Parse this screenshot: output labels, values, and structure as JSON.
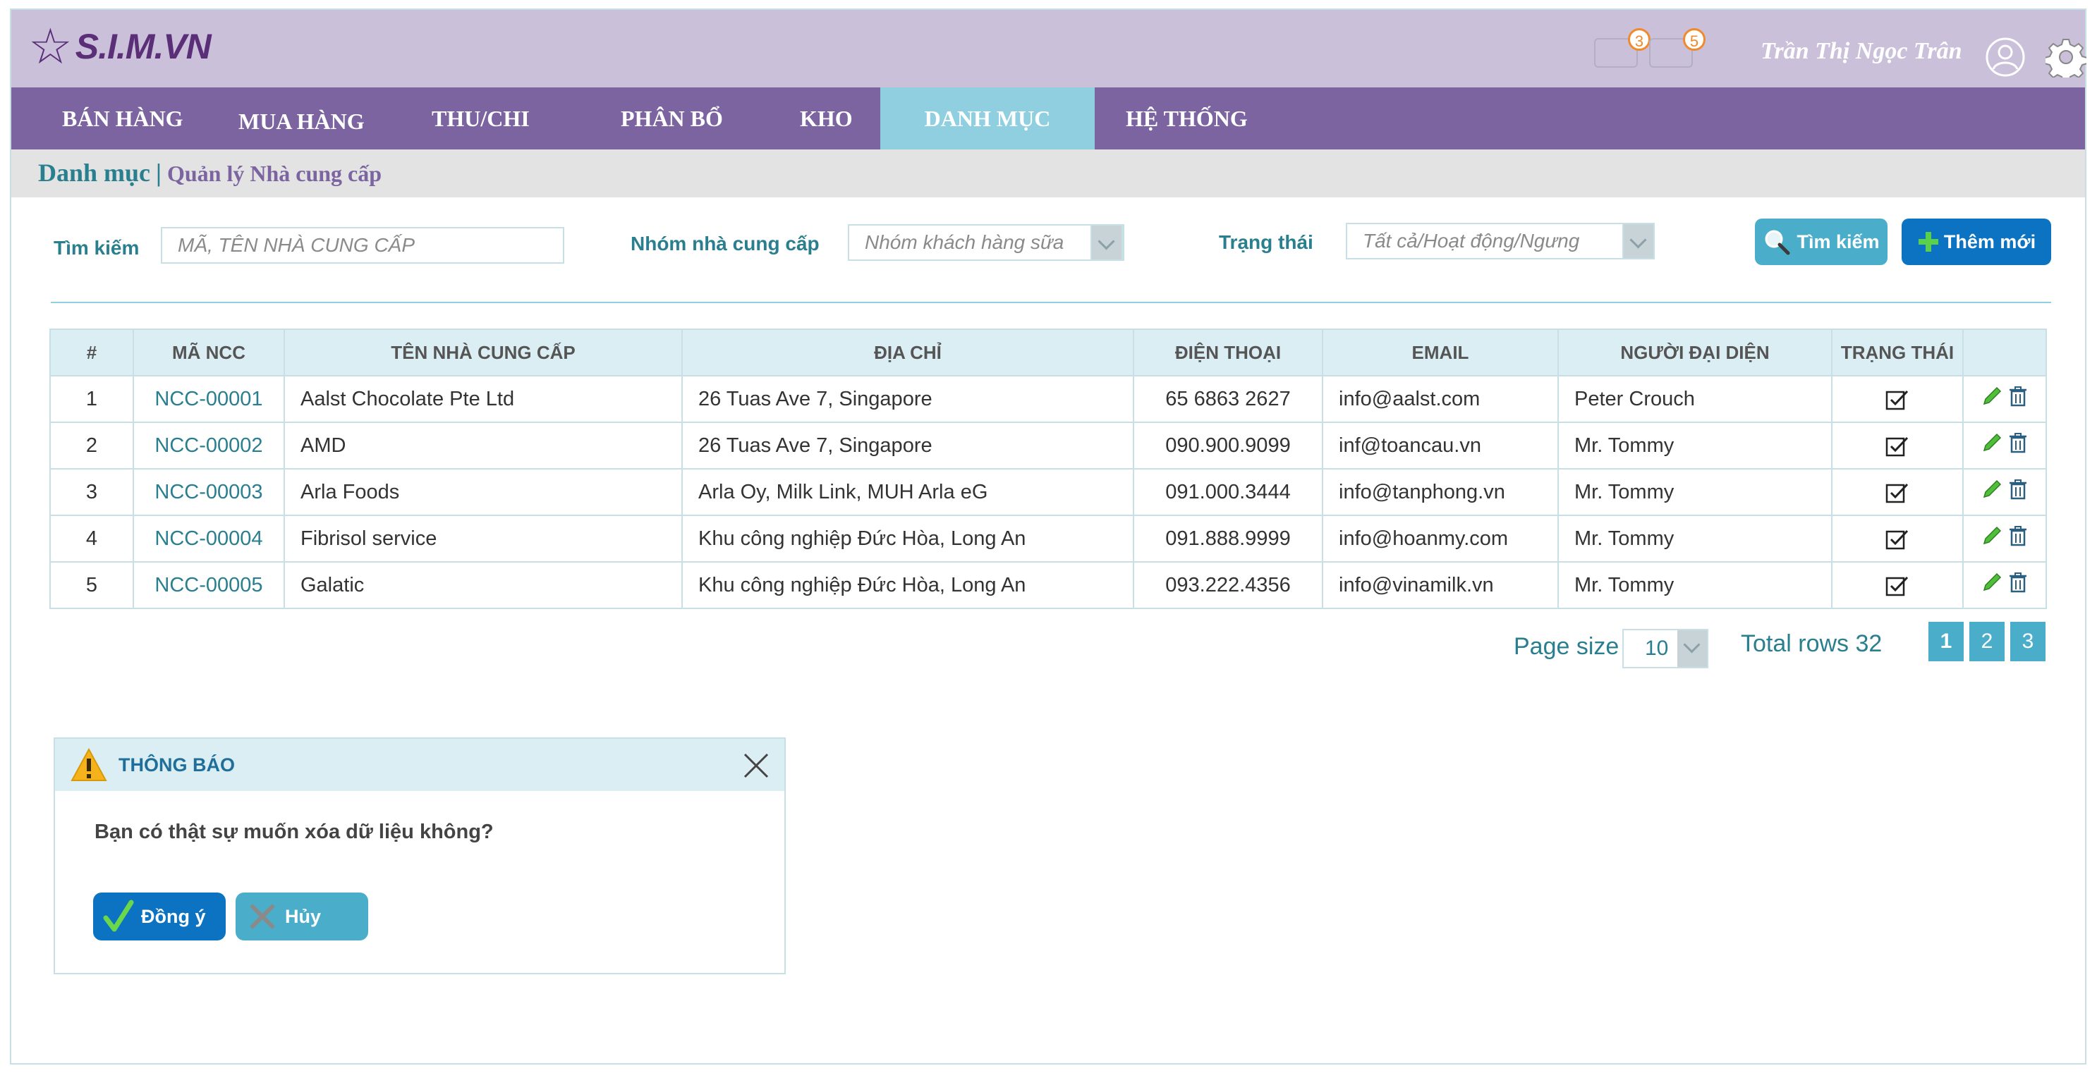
{
  "brand": {
    "logo_text": "S.I.M.VN"
  },
  "header": {
    "notifications": [
      {
        "icon": "bell-icon",
        "count": "3"
      },
      {
        "icon": "mail-icon",
        "count": "5"
      }
    ],
    "user_name": "Trần Thị Ngọc Trân"
  },
  "nav": {
    "items": [
      {
        "label": "BÁN HÀNG"
      },
      {
        "label": "MUA HÀNG"
      },
      {
        "label": "THU/CHI"
      },
      {
        "label": "PHÂN BỔ"
      },
      {
        "label": "KHO"
      },
      {
        "label": "DANH MỤC"
      },
      {
        "label": "HỆ THỐNG"
      }
    ],
    "active": "DANH MỤC"
  },
  "breadcrumb": {
    "section": "Danh mục",
    "separator": "|",
    "page": "Quản lý Nhà cung cấp"
  },
  "filters": {
    "search_label": "Tìm kiếm",
    "search_placeholder": "MÃ, TÊN NHÀ CUNG CẤP",
    "group_label": "Nhóm nhà cung cấp",
    "group_value": "Nhóm khách hàng sữa",
    "status_label": "Trạng thái",
    "status_value": "Tất cả/Hoạt động/Ngưng",
    "search_button": "Tìm kiếm",
    "add_button": "Thêm mới"
  },
  "table": {
    "headers": [
      "#",
      "MÃ NCC",
      "TÊN NHÀ CUNG CẤP",
      "ĐỊA CHỈ",
      "ĐIỆN THOẠI",
      "EMAIL",
      "NGƯỜI ĐẠI DIỆN",
      "TRẠNG THÁI",
      ""
    ],
    "rows": [
      {
        "no": "1",
        "code": "NCC-00001",
        "name": "Aalst Chocolate Pte Ltd",
        "address": "26 Tuas Ave 7, Singapore",
        "phone": "65 6863 2627",
        "email": "info@aalst.com",
        "rep": "Peter Crouch",
        "active": true
      },
      {
        "no": "2",
        "code": "NCC-00002",
        "name": "AMD",
        "address": "26 Tuas Ave 7, Singapore",
        "phone": "090.900.9099",
        "email": "inf@toancau.vn",
        "rep": "Mr. Tommy",
        "active": true
      },
      {
        "no": "3",
        "code": "NCC-00003",
        "name": "Arla Foods",
        "address": " Arla Oy, Milk Link, MUH Arla eG",
        "phone": "091.000.3444",
        "email": "info@tanphong.vn",
        "rep": "Mr. Tommy",
        "active": true
      },
      {
        "no": "4",
        "code": "NCC-00004",
        "name": "Fibrisol service",
        "address": "Khu công nghiệp Đức Hòa, Long An",
        "phone": "091.888.9999",
        "email": "info@hoanmy.com",
        "rep": "Mr. Tommy",
        "active": true
      },
      {
        "no": "5",
        "code": "NCC-00005",
        "name": "Galatic",
        "address": "Khu công nghiệp Đức Hòa, Long An",
        "phone": "093.222.4356",
        "email": "info@vinamilk.vn",
        "rep": "Mr. Tommy",
        "active": true
      }
    ]
  },
  "pagination": {
    "page_size_label": "Page size",
    "page_size": "10",
    "total_rows": "Total rows 32",
    "pages": [
      "1",
      "2",
      "3"
    ]
  },
  "dialog": {
    "title": "THÔNG BÁO",
    "message": "Bạn có thật sự muốn xóa dữ liệu không?",
    "ok": "Đồng ý",
    "cancel": "Hủy"
  },
  "colors": {
    "header_bg": "#cbc0da",
    "nav_bg": "#7b64a0",
    "nav_active": "#8fcfe0",
    "teal": "#2a7f8f",
    "primary_btn": "#0c73c2",
    "secondary_btn": "#4aaecb"
  }
}
